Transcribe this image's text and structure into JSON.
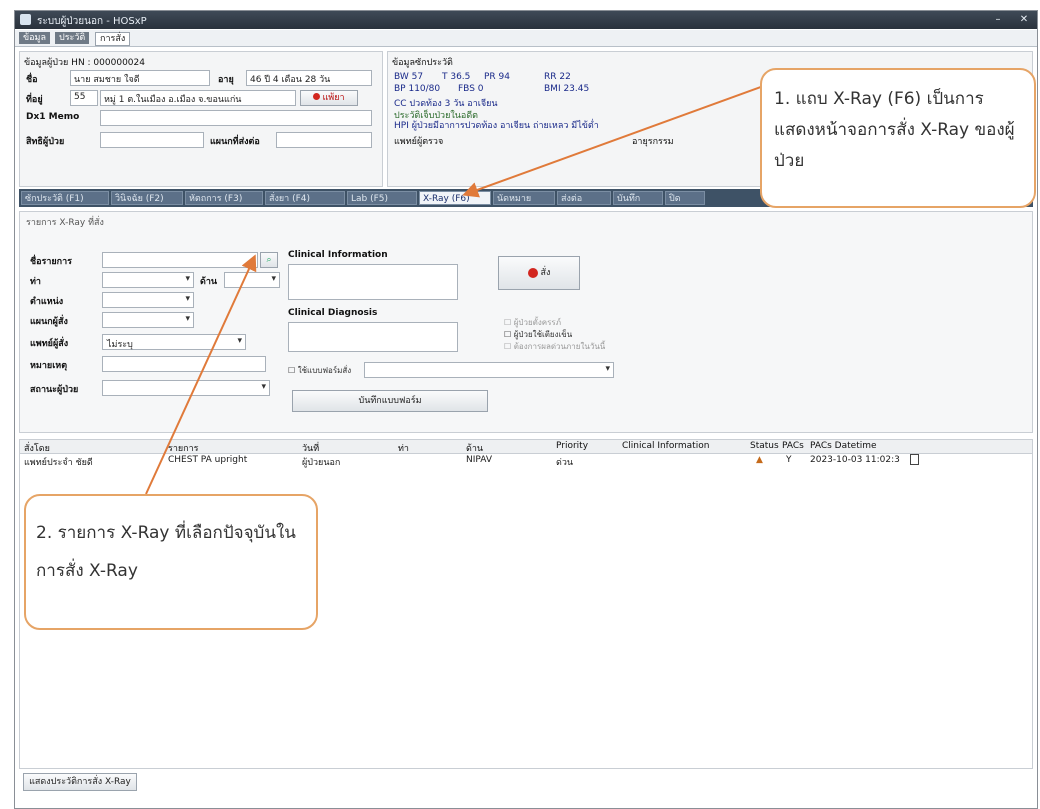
{
  "window": {
    "title": "ระบบผู้ป่วยนอก - HOSxP",
    "min": "–",
    "close": "✕"
  },
  "page_tabs": [
    "ข้อมูล",
    "ประวัติ",
    "การสั่ง"
  ],
  "patient": {
    "hn_header": "ข้อมูลผู้ป่วย HN : 000000024",
    "name_label": "ชื่อ",
    "name_value": "นาย สมชาย ใจดี",
    "age_label": "อายุ",
    "age_value": "46 ปี 4 เดือน 28 วัน",
    "addr_label": "ที่อยู่",
    "addr_no": "55",
    "addr_value": "หมู่ 1 ต.ในเมือง อ.เมือง จ.ขอนแก่น",
    "allergy_btn": "แพ้ยา",
    "dx_label": "Dx1 Memo",
    "right_label": "สิทธิผู้ป่วย",
    "dept_label": "แผนกที่ส่งต่อ"
  },
  "vitals": {
    "header": "ข้อมูลซักประวัติ",
    "bw": "BW 57",
    "t": "T 36.5",
    "pr": "PR 94",
    "rr": "RR 22",
    "bp": "BP 110/80",
    "fbs": "FBS 0",
    "bmi": "BMI 23.45",
    "cc": "CC ปวดท้อง 3 วัน อาเจียน",
    "hpi1": "ประวัติเจ็บป่วยในอดีต",
    "hpi2": "HPI ผู้ป่วยมีอาการปวดท้อง อาเจียน ถ่ายเหลว มีไข้ต่ำ",
    "doc_label": "แพทย์ผู้ตรวจ",
    "doc_value": "อายุรกรรม"
  },
  "nav_tabs": [
    "ซักประวัติ (F1)",
    "วินิจฉัย (F2)",
    "หัตถการ (F3)",
    "สั่งยา (F4)",
    "Lab (F5)",
    "X-Ray (F6)",
    "นัดหมาย",
    "ส่งต่อ",
    "บันทึก",
    "ปิด"
  ],
  "xray_form": {
    "group_label": "รายการ X-Ray ที่สั่ง",
    "item_label": "ชื่อรายการ",
    "side_label": "ด้าน",
    "position_label": "ท่า",
    "type_label": "ตำแหน่ง",
    "dept_label": "แผนกผู้สั่ง",
    "doctor_label": "แพทย์ผู้สั่ง",
    "doctor_value": "ไม่ระบุ",
    "note_label": "หมายเหตุ",
    "status_label": "สถานะผู้ป่วย",
    "clinical_info_label": "Clinical Information",
    "clinical_dx_label": "Clinical Diagnosis",
    "add_btn": "สั่ง",
    "chk1": "ผู้ป่วยตั้งครรภ์",
    "chk2": "ผู้ป่วยใช้เตียงเข็น",
    "chk3": "ต้องการผลด่วนภายในวันนี้",
    "template_chk": "ใช้แบบฟอร์มสั่ง",
    "template_btn": "บันทึกแบบฟอร์ม"
  },
  "table": {
    "headers": [
      "สั่งโดย",
      "รายการ",
      "วันที่",
      "ท่า",
      "ด้าน",
      "Priority",
      "Clinical Information",
      "Status",
      "PACs",
      "PACs Datetime"
    ],
    "rows": [
      [
        "แพทย์ประจำ ชัยดี",
        "CHEST PA upright",
        "ผู้ป่วยนอก",
        "",
        "NIPAV",
        "ด่วน",
        "",
        "▲",
        "Y",
        "2023-10-03 11:02:3"
      ]
    ]
  },
  "footer_btn": "แสดงประวัติการสั่ง X-Ray",
  "callout1": {
    "text": "1. แถบ X-Ray (F6) เป็นการแสดงหน้าจอการสั่ง X-Ray ของผู้ป่วย"
  },
  "callout2": {
    "text": "2. รายการ X-Ray ที่เลือกปัจจุบันในการสั่ง X-Ray"
  },
  "colors": {
    "accent": "#e6a466",
    "title_bar": "#2a323c",
    "nav_bar": "#3e5266",
    "arrow": "#e07a3a"
  }
}
